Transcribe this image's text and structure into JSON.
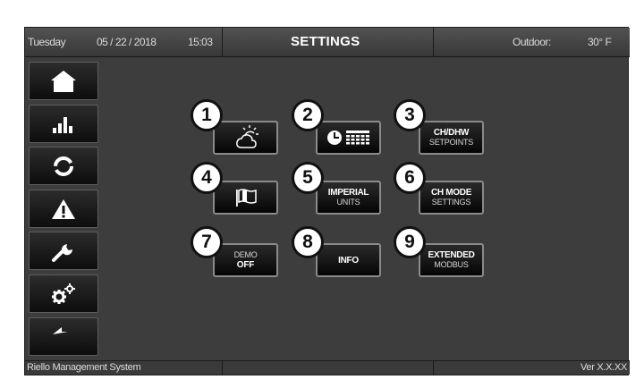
{
  "header": {
    "day": "Tuesday",
    "date": "05 / 22 / 2018",
    "time": "15:03",
    "title": "SETTINGS",
    "outdoor_label": "Outdoor:",
    "outdoor_value": "30° F"
  },
  "sidebar": {
    "items": [
      {
        "icon": "home-icon"
      },
      {
        "icon": "bar-chart-icon"
      },
      {
        "icon": "cycle-icon"
      },
      {
        "icon": "warning-icon"
      },
      {
        "icon": "wrench-icon"
      },
      {
        "icon": "gears-icon"
      },
      {
        "icon": "back-arrow-icon"
      }
    ]
  },
  "grid": {
    "buttons": [
      {
        "number": "1",
        "icon": "weather-icon"
      },
      {
        "number": "2",
        "icon": "clock-calendar-icon"
      },
      {
        "number": "3",
        "line1": "CH/DHW",
        "line2": "SETPOINTS"
      },
      {
        "number": "4",
        "icon": "flag-icon"
      },
      {
        "number": "5",
        "line1": "IMPERIAL",
        "line2": "UNITS"
      },
      {
        "number": "6",
        "line1": "CH MODE",
        "line2": "SETTINGS"
      },
      {
        "number": "7",
        "line1": "DEMO",
        "line2": "OFF"
      },
      {
        "number": "8",
        "line1": "INFO"
      },
      {
        "number": "9",
        "line1": "EXTENDED",
        "line2": "MODBUS"
      }
    ]
  },
  "footer": {
    "left": "Riello Management System",
    "right": "Ver X.X.XX"
  }
}
